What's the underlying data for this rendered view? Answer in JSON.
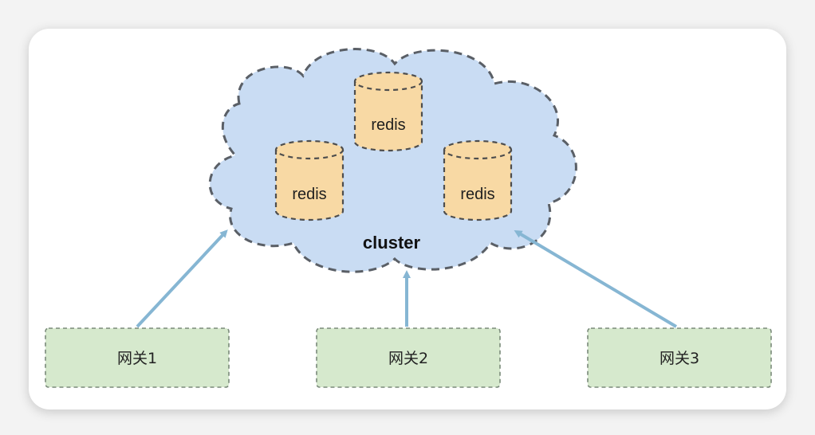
{
  "diagram": {
    "cluster": {
      "label": "cluster",
      "nodes": [
        {
          "label": "redis"
        },
        {
          "label": "redis"
        },
        {
          "label": "redis"
        }
      ]
    },
    "gateways": [
      {
        "label": "网关1"
      },
      {
        "label": "网关2"
      },
      {
        "label": "网关3"
      }
    ]
  },
  "colors": {
    "cloud_fill": "#c9dcf3",
    "cloud_stroke": "#5a5f66",
    "db_fill": "#f8d9a4",
    "db_stroke": "#4d4d4d",
    "gateway_fill": "#d6e9cd",
    "gateway_stroke": "#7a8a7a",
    "arrow": "#86b6d3"
  }
}
